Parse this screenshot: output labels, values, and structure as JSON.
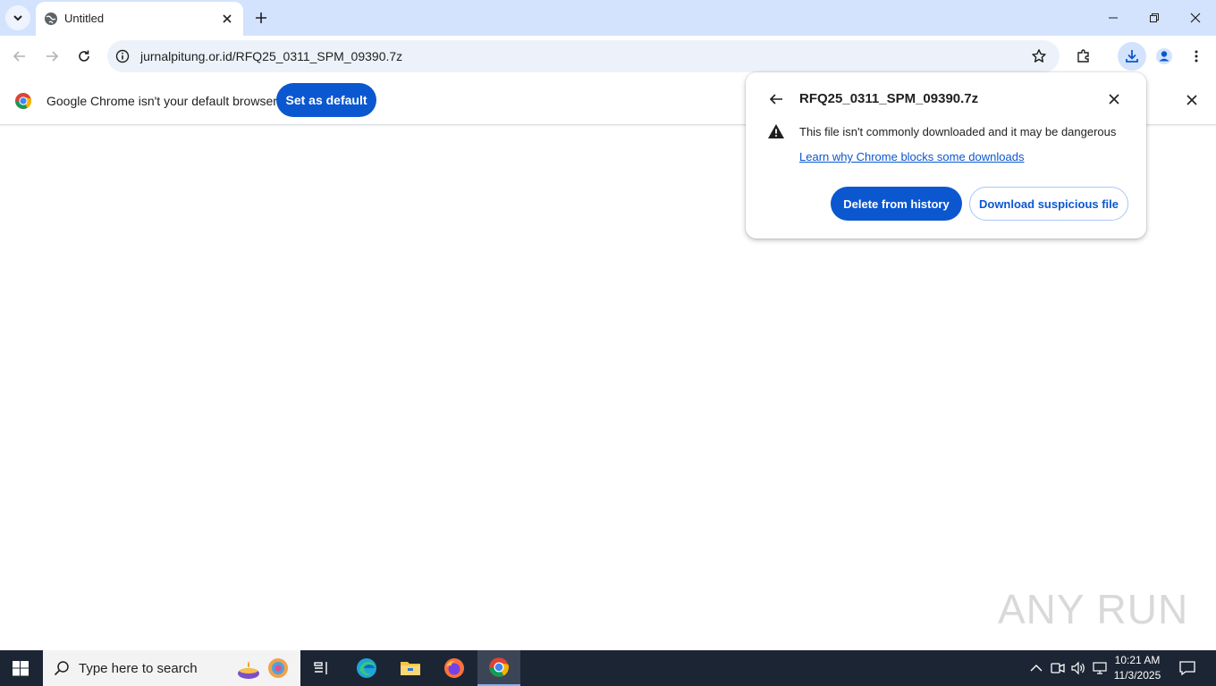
{
  "tab": {
    "title": "Untitled"
  },
  "omnibox": {
    "url": "jurnalpitung.or.id/RFQ25_0311_SPM_09390.7z"
  },
  "infobar": {
    "message": "Google Chrome isn't your default browser",
    "button_label": "Set as default"
  },
  "download_bubble": {
    "filename": "RFQ25_0311_SPM_09390.7z",
    "warning": "This file isn't commonly downloaded and it may be dangerous",
    "link": "Learn why Chrome blocks some downloads",
    "primary_button": "Delete from history",
    "secondary_button": "Download suspicious file"
  },
  "watermark": "ANY RUN",
  "taskbar": {
    "search_placeholder": "Type here to search",
    "time": "10:21 AM",
    "date": "11/3/2025",
    "apps": [
      "task-view",
      "edge",
      "file-explorer",
      "firefox",
      "chrome"
    ]
  },
  "colors": {
    "accent": "#0b57d0",
    "tabstrip": "#d3e3fd",
    "taskbar": "#1c2533"
  }
}
